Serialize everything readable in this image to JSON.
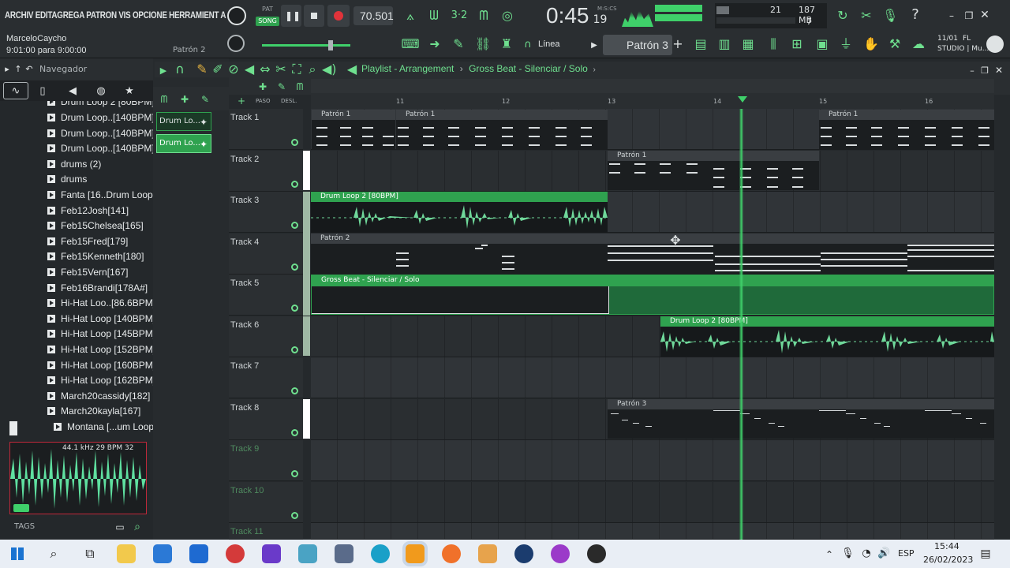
{
  "menu_text": "ARCHIV EDITAGREGA PATRON VIS OPCIONE HERRAMIENT A",
  "transport": {
    "pat_label": "PAT",
    "song_label": "SONG",
    "tempo": "70.501",
    "time": "0:45",
    "time_small": "19",
    "time_unit": "M:S:CS",
    "cpu": "21",
    "mem": "187 MB",
    "mem_small": "7"
  },
  "hint": {
    "user": "MarceloCaycho",
    "time_range": "9:01:00 para 9:00:00"
  },
  "toolbar2": {
    "pattern_small": "Patrón 2",
    "snap": "Línea",
    "pattern_selector": "Patrón 3",
    "news_date": "11/01",
    "news_line1": "FL",
    "news_line2": "STUDIO | Mu..."
  },
  "browser": {
    "title": "Navegador",
    "items": [
      "Drum Loop 2 [80BPM]",
      "Drum Loop..[140BPM]",
      "Drum Loop..[140BPM]",
      "Drum Loop..[140BPM]",
      "drums (2)",
      "drums",
      "Fanta [16..Drum Loop",
      "Feb12Josh[141]",
      "Feb15Chelsea[165]",
      "Feb15Fred[179]",
      "Feb15Kenneth[180]",
      "Feb15Vern[167]",
      "Feb16Brandi[178A#]",
      "Hi-Hat Loo..[86.6BPM]",
      "Hi-Hat Loop [140BPM]",
      "Hi-Hat Loop [145BPM]",
      "Hi-Hat Loop [152BPM]",
      "Hi-Hat Loop [160BPM]",
      "Hi-Hat Loop [162BPM]",
      "March20cassidy[182]",
      "March20kayla[167]",
      "Montana [...um Loop"
    ],
    "preview_info": "44.1 kHz 29 BPM 32",
    "tags_label": "TAGS"
  },
  "channels": [
    "Drum Lo...",
    "Drum Lo..."
  ],
  "playlist": {
    "title": "Playlist - Arrangement",
    "sep": "›",
    "crumb": "Gross Beat - Silenciar / Solo",
    "paso": "PASO",
    "desl": "DESL.",
    "bars": [
      "11",
      "12",
      "13",
      "14",
      "15",
      "16"
    ],
    "tracks": [
      "Track 1",
      "Track 2",
      "Track 3",
      "Track 4",
      "Track 5",
      "Track 6",
      "Track 7",
      "Track 8",
      "Track 9",
      "Track 10",
      "Track 11"
    ],
    "clips": {
      "t1a": "Patrón 1",
      "t1b": "Patrón 1",
      "t1c": "Patrón 1",
      "t2": "Patrón 1",
      "t3": "Drum Loop 2 [80BPM]",
      "t4": "Patrón 2",
      "t5": "Gross Beat - Silenciar / Solo",
      "t6": "Drum Loop 2 [80BPM]",
      "t8": "Patrón 3"
    }
  },
  "taskbar": {
    "lang": "ESP",
    "clock_time": "15:44",
    "clock_date": "26/02/2023"
  },
  "colors": {
    "accent": "#6fe08f",
    "clip_green": "#2fa24f"
  }
}
